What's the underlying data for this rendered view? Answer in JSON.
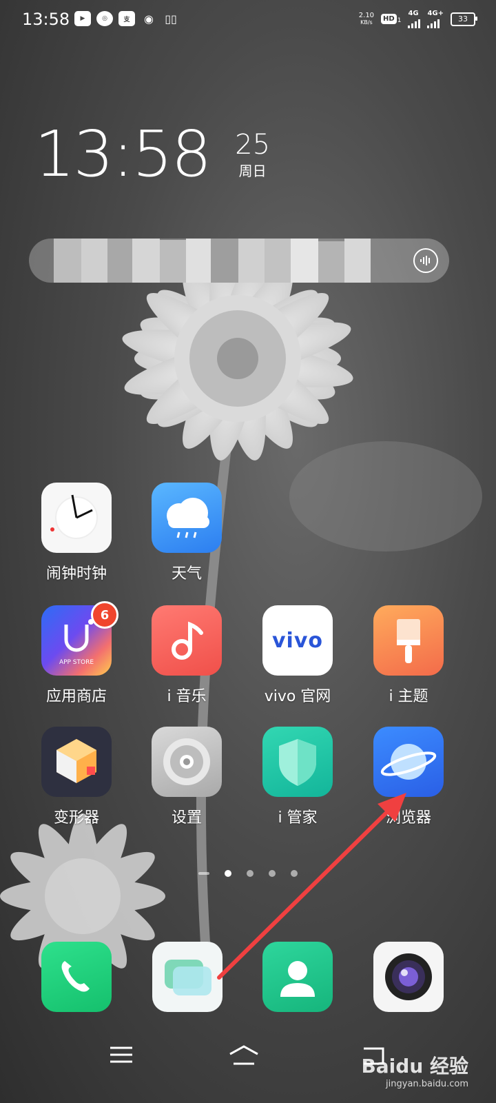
{
  "status_bar": {
    "time": "13:58",
    "notification_icons": [
      "youku-icon",
      "app-icon",
      "alipay-icon",
      "weibo-icon",
      "book-icon"
    ],
    "net_speed_value": "2.10",
    "net_speed_unit": "KB/s",
    "hd_label": "HD",
    "hd_sub": "1",
    "sim1_label": "4G",
    "sim2_label": "4G+",
    "battery": "33"
  },
  "clock_widget": {
    "time": "13:58",
    "day": "25",
    "weekday": "周日"
  },
  "search": {
    "voice_icon": "voice-icon"
  },
  "apps": [
    {
      "label": "闹钟时钟",
      "icon": "alarm-clock-icon"
    },
    {
      "label": "天气",
      "icon": "weather-icon"
    },
    {
      "label": "应用商店",
      "icon": "app-store-icon",
      "badge": "6",
      "icon_text": "APP STORE"
    },
    {
      "label": "i 音乐",
      "icon": "music-icon"
    },
    {
      "label": "vivo 官网",
      "icon": "vivo-icon",
      "icon_text": "vivo"
    },
    {
      "label": "i 主题",
      "icon": "theme-brush-icon"
    },
    {
      "label": "变形器",
      "icon": "transformer-icon"
    },
    {
      "label": "设置",
      "icon": "settings-gear-icon"
    },
    {
      "label": "i 管家",
      "icon": "manager-shield-icon"
    },
    {
      "label": "浏览器",
      "icon": "browser-planet-icon"
    }
  ],
  "page_indicator": {
    "count": 5,
    "active_index": 1
  },
  "dock": [
    {
      "icon": "phone-icon"
    },
    {
      "icon": "messages-icon"
    },
    {
      "icon": "contacts-icon"
    },
    {
      "icon": "camera-icon"
    }
  ],
  "nav": {
    "menu_icon": "menu-icon",
    "home_icon": "home-icon",
    "back_icon": "back-icon"
  },
  "watermark": {
    "main": "Baidu 经验",
    "sub": "jingyan.baidu.com"
  },
  "colors": {
    "arrow": "#f04040",
    "badge": "#f0452d"
  }
}
